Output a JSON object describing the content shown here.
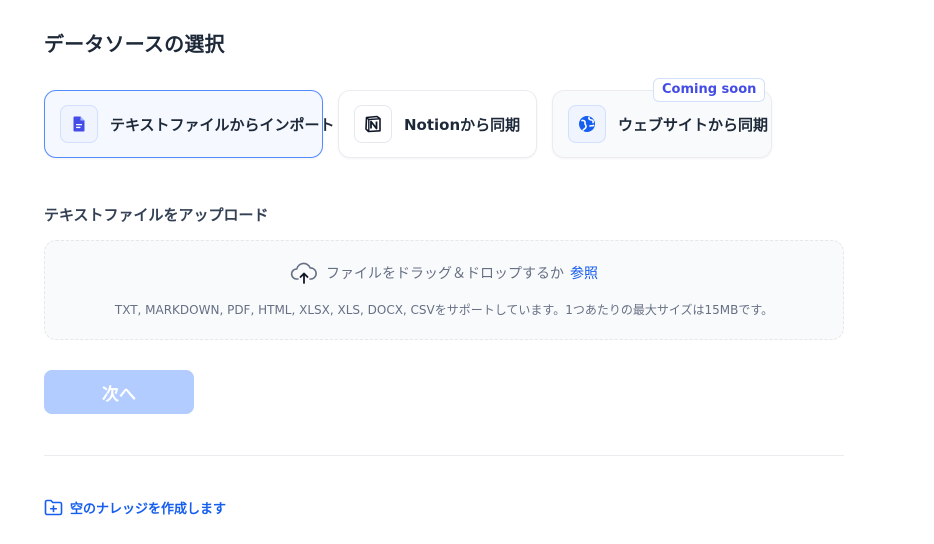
{
  "page": {
    "title": "データソースの選択"
  },
  "sources": {
    "file": {
      "label": "テキストファイルからインポート",
      "icon": "document-icon"
    },
    "notion": {
      "label": "Notionから同期",
      "icon": "notion-icon"
    },
    "web": {
      "label": "ウェブサイトから同期",
      "icon": "globe-icon",
      "badge": "Coming soon"
    }
  },
  "upload": {
    "section_title": "テキストファイルをアップロード",
    "prompt": "ファイルをドラッグ＆ドロップするか",
    "browse_label": "参照",
    "hint": "TXT, MARKDOWN, PDF, HTML, XLSX, XLS, DOCX, CSVをサポートしています。1つあたりの最大サイズは15MBです。"
  },
  "actions": {
    "next_label": "次へ",
    "empty_kb_label": "空のナレッジを作成します"
  },
  "colors": {
    "accent": "#155eef",
    "active_border": "#528bff",
    "disabled_button": "#b2ccff",
    "badge_text": "#444ce7"
  }
}
